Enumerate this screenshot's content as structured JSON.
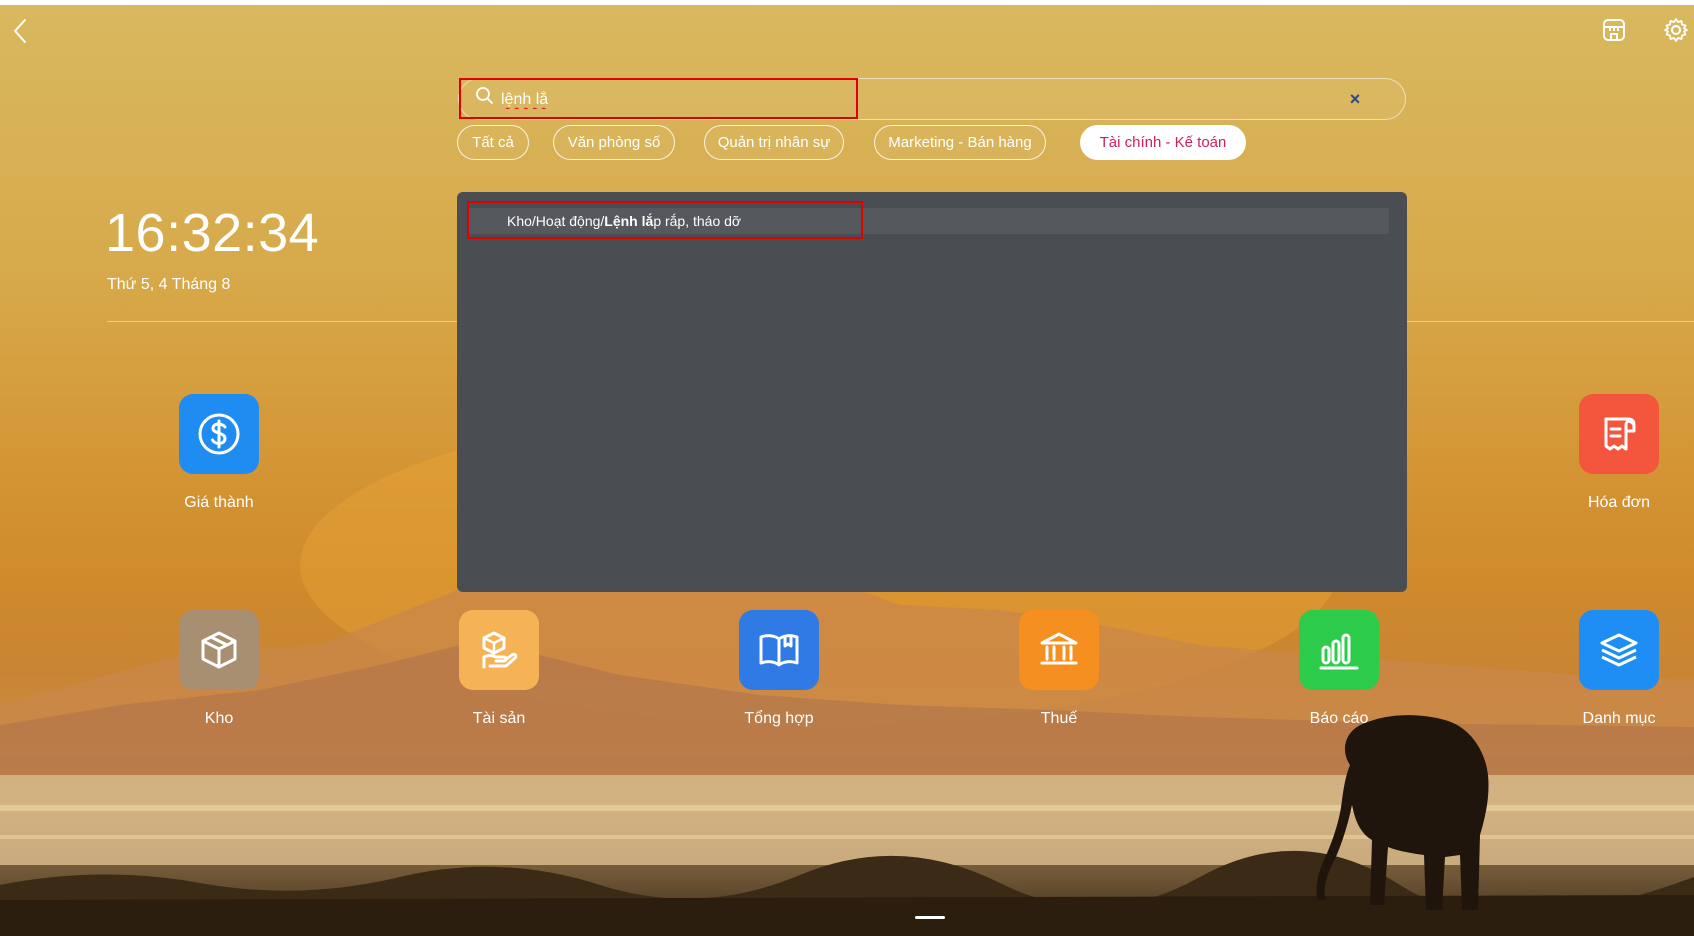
{
  "search": {
    "value": "lệnh lắ",
    "clear_label": "×"
  },
  "filters": [
    {
      "label": "Tất cả",
      "active": false
    },
    {
      "label": "Văn phòng số",
      "active": false
    },
    {
      "label": "Quản trị nhân sự",
      "active": false
    },
    {
      "label": "Marketing - Bán hàng",
      "active": false
    },
    {
      "label": "Tài chính - Kế toán",
      "active": true
    }
  ],
  "clock": {
    "time": "16:32:34",
    "date": "Thứ 5, 4 Tháng 8"
  },
  "results": [
    {
      "prefix": "Kho/Hoạt động/",
      "match": "Lệnh lắ",
      "suffix": "p rắp, tháo dỡ"
    }
  ],
  "apps": {
    "gia_thanh": {
      "label": "Giá thành",
      "icon": "dollar-icon",
      "color": "#1f8cf2"
    },
    "hoa_don": {
      "label": "Hóa đơn",
      "icon": "receipt-icon",
      "color": "#f4553d"
    },
    "kho": {
      "label": "Kho",
      "icon": "box-icon",
      "color": "#a88f72"
    },
    "tai_san": {
      "label": "Tài sản",
      "icon": "hand-box-icon",
      "color": "#f6b356"
    },
    "tong_hop": {
      "label": "Tổng hợp",
      "icon": "book-icon",
      "color": "#2f7ae5"
    },
    "thue": {
      "label": "Thuế",
      "icon": "bank-icon",
      "color": "#f58f1f"
    },
    "bao_cao": {
      "label": "Báo cáo",
      "icon": "bar-chart-icon",
      "color": "#2ccc4a"
    },
    "danh_muc": {
      "label": "Danh mục",
      "icon": "layers-icon",
      "color": "#1e8ef5"
    }
  },
  "colors": {
    "highlight": "#e00000",
    "active_chip_text": "#d21f57",
    "results_bg": "#4a4d51"
  }
}
